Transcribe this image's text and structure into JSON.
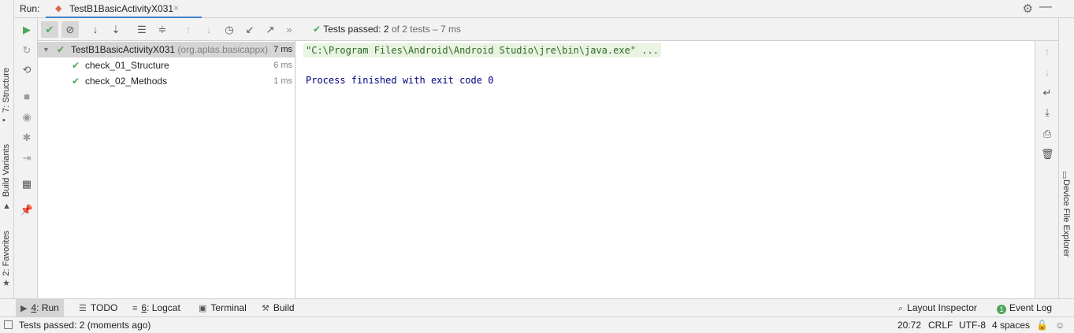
{
  "run_header": {
    "label": "Run:",
    "tab_title": "TestB1BasicActivityX031",
    "tab_icon": "run-config-icon",
    "close_glyph": "×",
    "gear_icon": "gear-icon",
    "minimize_icon": "minimize-icon"
  },
  "left_strip": {
    "structure": "7: Structure",
    "build_variants": "Build Variants",
    "favorites": "2: Favorites"
  },
  "right_strip": {
    "device_file_explorer": "Device File Explorer"
  },
  "test_toolbar": {
    "status_prefix": "Tests passed:",
    "passed_count": "2",
    "status_suffix": "of 2 tests – 7 ms",
    "more_glyph": "»"
  },
  "test_tree": {
    "rows": [
      {
        "name": "TestB1BasicActivityX031",
        "package": "(org.aplas.basicappx)",
        "time": "7 ms"
      },
      {
        "name": "check_01_Structure",
        "time": "6 ms"
      },
      {
        "name": "check_02_Methods",
        "time": "1 ms"
      }
    ]
  },
  "console": {
    "command_line": "\"C:\\Program Files\\Android\\Android Studio\\jre\\bin\\java.exe\" ...",
    "exit_line": "Process finished with exit code 0"
  },
  "tool_windows": {
    "run_prefix": "4",
    "run_label": ": Run",
    "todo": "TODO",
    "logcat_prefix": "6",
    "logcat_label": ": Logcat",
    "terminal": "Terminal",
    "build": "Build",
    "layout_inspector": "Layout Inspector",
    "event_log_count": "1",
    "event_log": "Event Log"
  },
  "status_bar": {
    "message": "Tests passed: 2 (moments ago)",
    "position": "20:72",
    "line_sep": "CRLF",
    "encoding": "UTF-8",
    "indent": "4 spaces"
  },
  "colors": {
    "accent": "#4083c9",
    "pass_green": "#4da658",
    "console_cmd_bg": "#e9f3e1",
    "console_exit": "#000080"
  }
}
